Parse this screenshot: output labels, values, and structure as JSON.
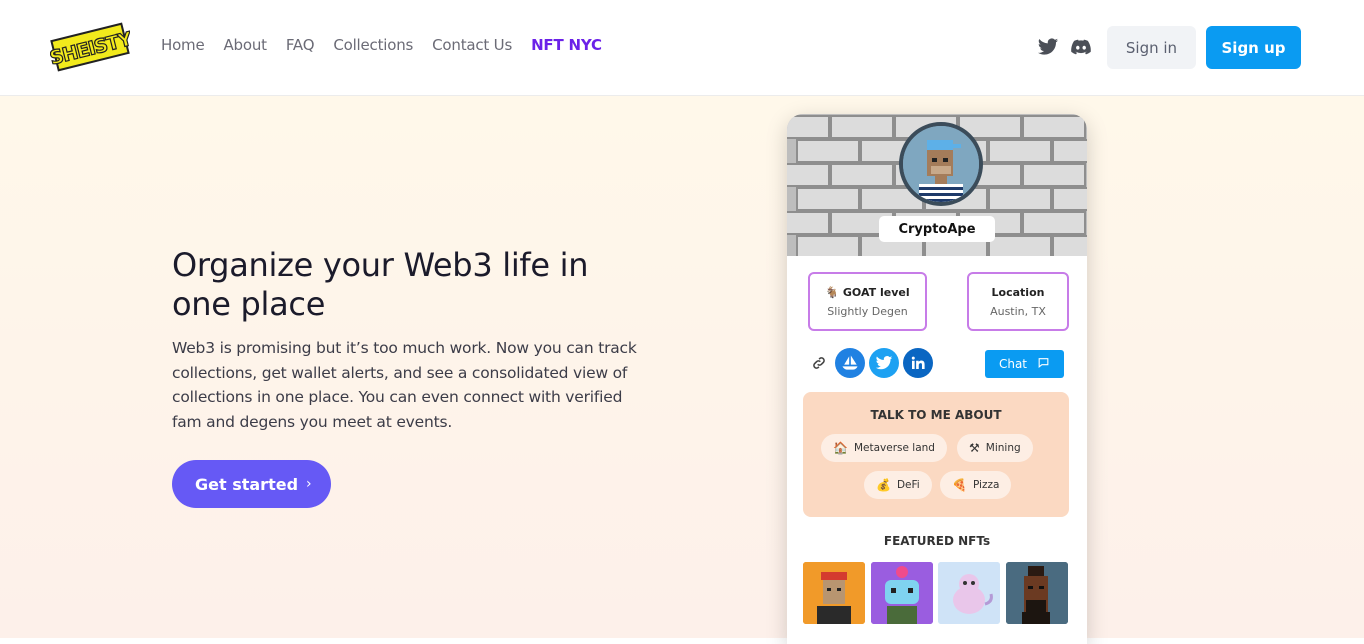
{
  "brand": {
    "logo_text": "SHEISTY"
  },
  "nav": {
    "links": [
      "Home",
      "About",
      "FAQ",
      "Collections",
      "Contact Us",
      "NFT NYC"
    ],
    "signin": "Sign in",
    "signup": "Sign up",
    "icons": [
      "twitter-icon",
      "discord-icon"
    ]
  },
  "hero": {
    "headline": "Organize your Web3 life in one place",
    "body": "Web3 is promising but it’s too much work. Now you can track collections, get wallet alerts, and see a consolidated view of collections in one place. You can even connect with verified fam and degens you meet at events.",
    "cta": "Get started"
  },
  "profile": {
    "name": "CryptoApe",
    "goat_title": "GOAT level",
    "goat_emoji": "🐐",
    "goat_value": "Slightly Degen",
    "location_title": "Location",
    "location_value": "Austin, TX",
    "chat": "Chat",
    "talk_title": "TALK TO ME ABOUT",
    "topics": [
      {
        "emoji": "🏠",
        "label": "Metaverse land"
      },
      {
        "emoji": "⚒",
        "label": "Mining"
      },
      {
        "emoji": "💰",
        "label": "DeFi"
      },
      {
        "emoji": "🍕",
        "label": "Pizza"
      }
    ],
    "featured_title": "FEATURED NFTs"
  },
  "colors": {
    "accent": "#6659f5",
    "primary_blue": "#0a9bf2",
    "nav_active": "#6b21e8",
    "info_border": "#c77ce8",
    "talk_bg": "#fbd9c2"
  }
}
